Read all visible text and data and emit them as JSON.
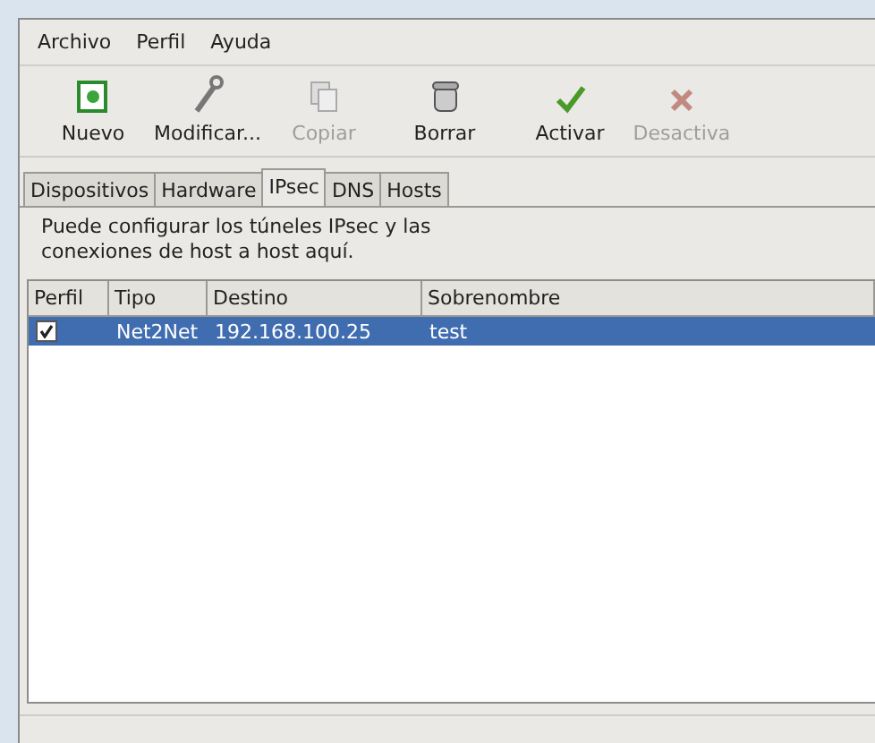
{
  "menu": [
    {
      "label": "Archivo"
    },
    {
      "label": "Perfil"
    },
    {
      "label": "Ayuda"
    }
  ],
  "toolbar": [
    {
      "label": "Nuevo",
      "disabled": false
    },
    {
      "label": "Modificar...",
      "disabled": false
    },
    {
      "label": "Copiar",
      "disabled": true
    },
    {
      "label": "Borrar",
      "disabled": false
    },
    {
      "label": "Activar",
      "disabled": false
    },
    {
      "label": "Desactiva",
      "disabled": true
    }
  ],
  "tabs": [
    {
      "label": "Dispositivos",
      "selected": false
    },
    {
      "label": "Hardware",
      "selected": false
    },
    {
      "label": "IPsec",
      "selected": true
    },
    {
      "label": "DNS",
      "selected": false
    },
    {
      "label": "Hosts",
      "selected": false
    }
  ],
  "description": "Puede configurar los túneles IPsec y las conexiones de host a host aquí.",
  "table": {
    "columns": [
      "Perfil",
      "Tipo",
      "Destino",
      "Sobrenombre"
    ],
    "rows": [
      {
        "checked": true,
        "selected": true,
        "tipo": "Net2Net",
        "destino": "192.168.100.25",
        "sobrenombre": "test"
      }
    ]
  }
}
